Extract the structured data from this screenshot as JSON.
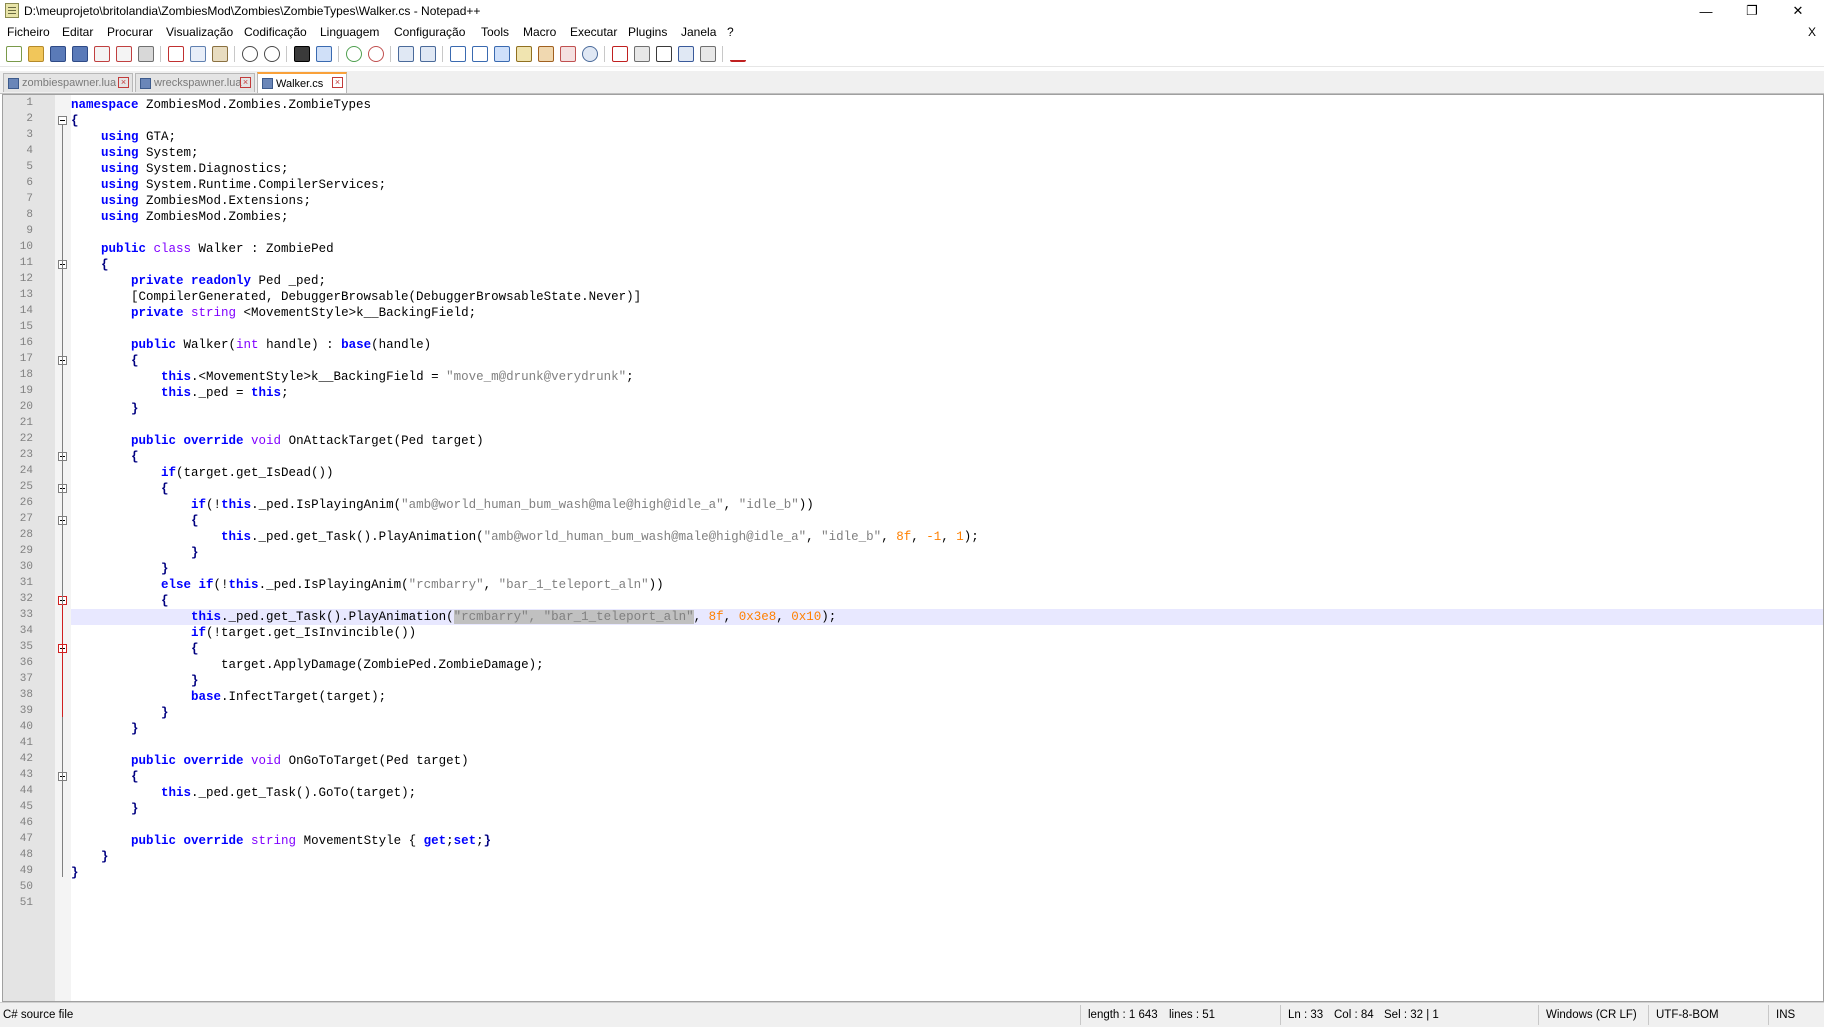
{
  "window": {
    "title": "D:\\meuprojeto\\britolandia\\ZombiesMod\\Zombies\\ZombieTypes\\Walker.cs - Notepad++",
    "minimize": "—",
    "restore": "❐",
    "close": "✕"
  },
  "menu": {
    "items": [
      "Ficheiro",
      "Editar",
      "Procurar",
      "Visualização",
      "Codificação",
      "Linguagem",
      "Configuração",
      "Tools",
      "Macro",
      "Executar",
      "Plugins",
      "Janela",
      "?"
    ],
    "close_doc": "X"
  },
  "tabs": [
    {
      "label": "zombiespawner.lua",
      "active": false
    },
    {
      "label": "wreckspawner.lua",
      "active": false
    },
    {
      "label": "Walker.cs",
      "active": true
    }
  ],
  "editor": {
    "current_line": 33,
    "line_numbers": [
      "1",
      "2",
      "3",
      "4",
      "5",
      "6",
      "7",
      "8",
      "9",
      "10",
      "11",
      "12",
      "13",
      "14",
      "15",
      "16",
      "17",
      "18",
      "19",
      "20",
      "21",
      "22",
      "23",
      "24",
      "25",
      "26",
      "27",
      "28",
      "29",
      "30",
      "31",
      "32",
      "33",
      "34",
      "35",
      "36",
      "37",
      "38",
      "39",
      "40",
      "41",
      "42",
      "43",
      "44",
      "45",
      "46",
      "47",
      "48",
      "49",
      "50",
      "51"
    ],
    "lines": [
      [
        [
          "kw",
          "namespace"
        ],
        [
          "",
          "ZombiesMod.Zombies.ZombieTypes"
        ]
      ],
      [
        [
          "op",
          "{"
        ]
      ],
      [
        [
          "",
          "    "
        ],
        [
          "kw",
          "using"
        ],
        [
          "",
          "GTA;"
        ]
      ],
      [
        [
          "",
          "    "
        ],
        [
          "kw",
          "using"
        ],
        [
          "",
          "System;"
        ]
      ],
      [
        [
          "",
          "    "
        ],
        [
          "kw",
          "using"
        ],
        [
          "",
          "System.Diagnostics;"
        ]
      ],
      [
        [
          "",
          "    "
        ],
        [
          "kw",
          "using"
        ],
        [
          "",
          "System.Runtime.CompilerServices;"
        ]
      ],
      [
        [
          "",
          "    "
        ],
        [
          "kw",
          "using"
        ],
        [
          "",
          "ZombiesMod.Extensions;"
        ]
      ],
      [
        [
          "",
          "    "
        ],
        [
          "kw",
          "using"
        ],
        [
          "",
          "ZombiesMod.Zombies;"
        ]
      ],
      [],
      [
        [
          "",
          "    "
        ],
        [
          "kw",
          "public"
        ],
        [
          "ty",
          "class"
        ],
        [
          "",
          "Walker : ZombiePed"
        ]
      ],
      [
        [
          "",
          "    "
        ],
        [
          "op",
          "{"
        ]
      ],
      [
        [
          "",
          "        "
        ],
        [
          "kw",
          "private"
        ],
        [
          "kw",
          "readonly"
        ],
        [
          "",
          "Ped _ped;"
        ]
      ],
      [
        [
          "",
          "        [CompilerGenerated, DebuggerBrowsable(DebuggerBrowsableState.Never)]"
        ]
      ],
      [
        [
          "",
          "        "
        ],
        [
          "kw",
          "private"
        ],
        [
          "ty",
          "string"
        ],
        [
          "",
          "<MovementStyle>k__BackingField;"
        ]
      ],
      [],
      [
        [
          "",
          "        "
        ],
        [
          "kw",
          "public"
        ],
        [
          "",
          "Walker("
        ],
        [
          "ty",
          "int"
        ],
        [
          "",
          "handle) : "
        ],
        [
          "kw",
          "base"
        ],
        [
          "",
          "(handle)"
        ]
      ],
      [
        [
          "",
          "        "
        ],
        [
          "op",
          "{"
        ]
      ],
      [
        [
          "",
          "            "
        ],
        [
          "kw",
          "this"
        ],
        [
          "",
          ".<MovementStyle>k__BackingField = "
        ],
        [
          "st",
          "\"move_m@drunk@verydrunk\""
        ],
        [
          "",
          ";"
        ]
      ],
      [
        [
          "",
          "            "
        ],
        [
          "kw",
          "this"
        ],
        [
          "",
          "._ped = "
        ],
        [
          "kw",
          "this"
        ],
        [
          "",
          ";"
        ]
      ],
      [
        [
          "",
          "        "
        ],
        [
          "op",
          "}"
        ]
      ],
      [],
      [
        [
          "",
          "        "
        ],
        [
          "kw",
          "public"
        ],
        [
          "kw",
          "override"
        ],
        [
          "ty",
          "void"
        ],
        [
          "",
          "OnAttackTarget(Ped target)"
        ]
      ],
      [
        [
          "",
          "        "
        ],
        [
          "op",
          "{"
        ]
      ],
      [
        [
          "",
          "            "
        ],
        [
          "kw",
          "if"
        ],
        [
          "",
          "(target.get_IsDead())"
        ]
      ],
      [
        [
          "",
          "            "
        ],
        [
          "op",
          "{"
        ]
      ],
      [
        [
          "",
          "                "
        ],
        [
          "kw",
          "if"
        ],
        [
          "",
          "(!"
        ],
        [
          "kw",
          "this"
        ],
        [
          "",
          "._ped.IsPlayingAnim("
        ],
        [
          "st",
          "\"amb@world_human_bum_wash@male@high@idle_a\""
        ],
        [
          "",
          ", "
        ],
        [
          "st",
          "\"idle_b\""
        ],
        [
          "",
          "))"
        ]
      ],
      [
        [
          "",
          "                "
        ],
        [
          "op",
          "{"
        ]
      ],
      [
        [
          "",
          "                    "
        ],
        [
          "kw",
          "this"
        ],
        [
          "",
          "._ped.get_Task().PlayAnimation("
        ],
        [
          "st",
          "\"amb@world_human_bum_wash@male@high@idle_a\""
        ],
        [
          "",
          ", "
        ],
        [
          "st",
          "\"idle_b\""
        ],
        [
          "",
          ", "
        ],
        [
          "nu",
          "8f"
        ],
        [
          "",
          ", "
        ],
        [
          "nu",
          "-1"
        ],
        [
          "",
          ", "
        ],
        [
          "nu",
          "1"
        ],
        [
          "",
          ");"
        ]
      ],
      [
        [
          "",
          "                "
        ],
        [
          "op",
          "}"
        ]
      ],
      [
        [
          "",
          "            "
        ],
        [
          "op",
          "}"
        ]
      ],
      [
        [
          "",
          "            "
        ],
        [
          "kw",
          "else if"
        ],
        [
          "",
          "(!"
        ],
        [
          "kw",
          "this"
        ],
        [
          "",
          "._ped.IsPlayingAnim("
        ],
        [
          "st",
          "\"rcmbarry\""
        ],
        [
          "",
          ", "
        ],
        [
          "st",
          "\"bar_1_teleport_aln\""
        ],
        [
          "",
          "))"
        ]
      ],
      [
        [
          "",
          "            "
        ],
        [
          "op",
          "{"
        ]
      ],
      [
        [
          "",
          "                "
        ],
        [
          "kw",
          "this"
        ],
        [
          "",
          "._ped.get_Task().PlayAnimation("
        ],
        [
          "sel st",
          "\"rcmbarry\", \"bar_1_teleport_aln\""
        ],
        [
          "",
          ", "
        ],
        [
          "nu",
          "8f"
        ],
        [
          "",
          ", "
        ],
        [
          "nu",
          "0x3e8"
        ],
        [
          "",
          ", "
        ],
        [
          "nu",
          "0x10"
        ],
        [
          "",
          ");"
        ]
      ],
      [
        [
          "",
          "                "
        ],
        [
          "kw",
          "if"
        ],
        [
          "",
          "(!target.get_IsInvincible())"
        ]
      ],
      [
        [
          "",
          "                "
        ],
        [
          "op",
          "{"
        ]
      ],
      [
        [
          "",
          "                    target.ApplyDamage(ZombiePed.ZombieDamage);"
        ]
      ],
      [
        [
          "",
          "                "
        ],
        [
          "op",
          "}"
        ]
      ],
      [
        [
          "",
          "                "
        ],
        [
          "kw",
          "base"
        ],
        [
          "",
          ".InfectTarget(target);"
        ]
      ],
      [
        [
          "",
          "            "
        ],
        [
          "op",
          "}"
        ]
      ],
      [
        [
          "",
          "        "
        ],
        [
          "op",
          "}"
        ]
      ],
      [],
      [
        [
          "",
          "        "
        ],
        [
          "kw",
          "public"
        ],
        [
          "kw",
          "override"
        ],
        [
          "ty",
          "void"
        ],
        [
          "",
          "OnGoToTarget(Ped target)"
        ]
      ],
      [
        [
          "",
          "        "
        ],
        [
          "op",
          "{"
        ]
      ],
      [
        [
          "",
          "            "
        ],
        [
          "kw",
          "this"
        ],
        [
          "",
          "._ped.get_Task().GoTo(target);"
        ]
      ],
      [
        [
          "",
          "        "
        ],
        [
          "op",
          "}"
        ]
      ],
      [],
      [
        [
          "",
          "        "
        ],
        [
          "kw",
          "public"
        ],
        [
          "kw",
          "override"
        ],
        [
          "ty",
          "string"
        ],
        [
          "",
          "MovementStyle { "
        ],
        [
          "kw",
          "get"
        ],
        [
          "",
          ";"
        ],
        [
          "kw",
          "set"
        ],
        [
          "",
          ";"
        ],
        [
          "op",
          "}"
        ]
      ],
      [
        [
          "",
          "    "
        ],
        [
          "op",
          "}"
        ]
      ],
      [
        [
          "op",
          "}"
        ]
      ],
      [],
      []
    ]
  },
  "status": {
    "filetype": "C# source file",
    "length": "length : 1 643",
    "lines": "lines : 51",
    "ln": "Ln : 33",
    "col": "Col : 84",
    "sel": "Sel : 32 | 1",
    "eol": "Windows (CR LF)",
    "encoding": "UTF-8-BOM",
    "mode": "INS"
  },
  "colors": {
    "keyword": "#0000ff",
    "type": "#8000ff",
    "string": "#808080",
    "number": "#ff8000",
    "current_line": "#e8e8ff",
    "active_tab_accent": "#f9a13a"
  }
}
